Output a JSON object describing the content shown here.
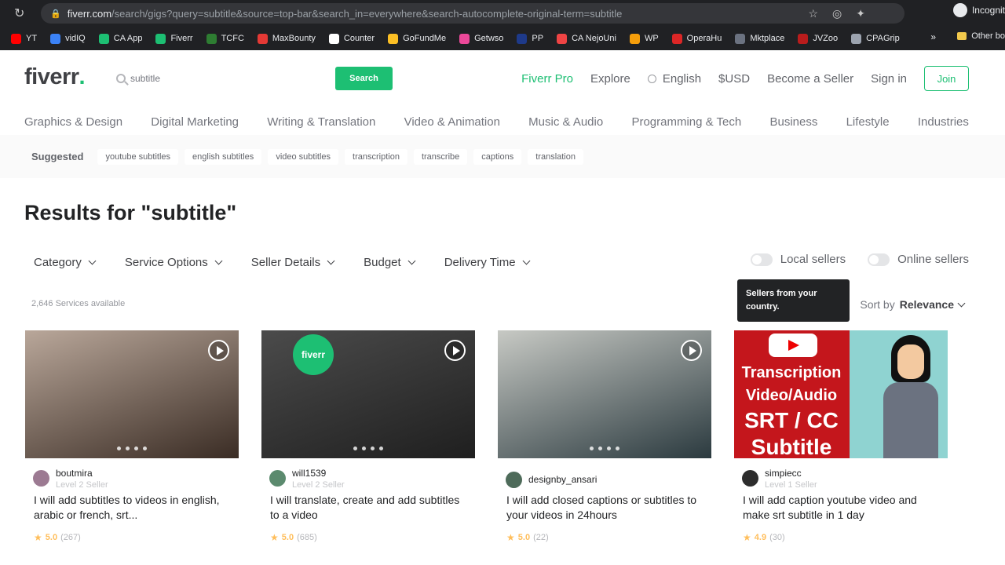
{
  "browser": {
    "url_host": "fiverr.com",
    "url_path": "/search/gigs?query=subtitle&source=top-bar&search_in=everywhere&search-autocomplete-original-term=subtitle",
    "profile_label": "Incognit",
    "bookmarks": [
      {
        "label": "YT",
        "color": "#ff0000"
      },
      {
        "label": "vidIQ",
        "color": "#3b82f6"
      },
      {
        "label": "CA App",
        "color": "#1dbf73"
      },
      {
        "label": "Fiverr",
        "color": "#1dbf73"
      },
      {
        "label": "TCFC",
        "color": "#2e7d32"
      },
      {
        "label": "MaxBounty",
        "color": "#e53935"
      },
      {
        "label": "Counter",
        "color": "#ffffff"
      },
      {
        "label": "GoFundMe",
        "color": "#fbbf24"
      },
      {
        "label": "Getwso",
        "color": "#ec4899"
      },
      {
        "label": "PP",
        "color": "#1e3a8a"
      },
      {
        "label": "CA NejoUni",
        "color": "#ef4444"
      },
      {
        "label": "WP",
        "color": "#f59e0b"
      },
      {
        "label": "OperaHu",
        "color": "#dc2626"
      },
      {
        "label": "Mktplace",
        "color": "#6b7280"
      },
      {
        "label": "JVZoo",
        "color": "#b91c1c"
      },
      {
        "label": "CPAGrip",
        "color": "#9ca3af"
      }
    ],
    "more_label": "»",
    "other_bookmarks": "Other bo"
  },
  "header": {
    "logo": "fiverr",
    "logo_dot": ".",
    "search_value": "subtitle",
    "search_button": "Search",
    "nav": {
      "pro": "Fiverr Pro",
      "explore": "Explore",
      "language": "English",
      "currency": "$USD",
      "become_seller": "Become a Seller",
      "sign_in": "Sign in",
      "join": "Join"
    }
  },
  "categories": [
    "Graphics & Design",
    "Digital Marketing",
    "Writing & Translation",
    "Video & Animation",
    "Music & Audio",
    "Programming & Tech",
    "Business",
    "Lifestyle",
    "Industries"
  ],
  "suggested": {
    "label": "Suggested",
    "chips": [
      "youtube subtitles",
      "english subtitles",
      "video subtitles",
      "transcription",
      "transcribe",
      "captions",
      "translation"
    ]
  },
  "results_title": "Results for \"subtitle\"",
  "filters": [
    "Category",
    "Service Options",
    "Seller Details",
    "Budget",
    "Delivery Time"
  ],
  "toggles": {
    "local": "Local sellers",
    "online": "Online sellers"
  },
  "tooltip": "Sellers from your country.",
  "services_count": "2,646 Services available",
  "sort": {
    "label": "Sort by",
    "value": "Relevance"
  },
  "gigs": [
    {
      "seller": "boutmira",
      "level": "Level 2 Seller",
      "title": "I will add subtitles to videos in english, arabic or french, srt...",
      "score": "5.0",
      "count": "(267)",
      "thumb_colors": [
        "#b9a79a",
        "#3a2c24"
      ],
      "avatar": "#9c7a92"
    },
    {
      "seller": "will1539",
      "level": "Level 2 Seller",
      "title": "I will translate, create and add subtitles to a video",
      "score": "5.0",
      "count": "(685)",
      "thumb_colors": [
        "#4b4b4b",
        "#1f1f1f"
      ],
      "avatar": "#5b8a6e"
    },
    {
      "seller": "designby_ansari",
      "level": "",
      "title": "I will add closed captions or subtitles to your videos in 24hours",
      "score": "5.0",
      "count": "(22)",
      "thumb_colors": [
        "#c7c9c4",
        "#2b3a3f"
      ],
      "avatar": "#4e6b5a"
    },
    {
      "seller": "simpiecc",
      "level": "Level 1 Seller",
      "title": "I will add caption youtube video and make srt subtitle in 1 day",
      "score": "4.9",
      "count": "(30)",
      "thumb_colors": [
        "#c4161c",
        "#8fd3d1"
      ],
      "avatar": "#2d2d2d"
    }
  ],
  "thumb4": {
    "line1": "Transcription",
    "line2": "Video/Audio",
    "line3": "SRT / CC",
    "line4": "Subtitle"
  },
  "thumb2_badge": "fiverr"
}
